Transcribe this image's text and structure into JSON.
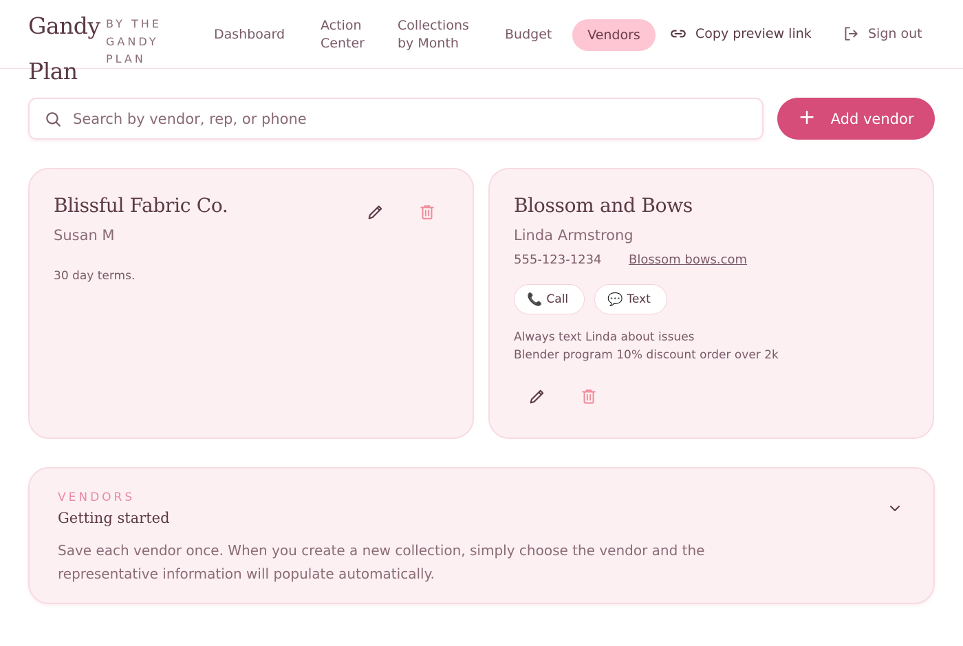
{
  "brand": {
    "line1": "Gandy",
    "line2": "Plan",
    "sub1": "BY THE",
    "sub2": "GANDY",
    "sub3": "PLAN"
  },
  "nav": {
    "dashboard": "Dashboard",
    "action_line1": "Action",
    "action_line2": "Center",
    "collections_line1": "Collections",
    "collections_line2": "by Month",
    "budget": "Budget",
    "vendors": "Vendors",
    "copy_link": "Copy preview link",
    "sign_out": "Sign out"
  },
  "search": {
    "placeholder": "Search by vendor, rep, or phone",
    "value": ""
  },
  "add_vendor": {
    "plus": "+",
    "label": "Add vendor"
  },
  "vendors": [
    {
      "name": "Blissful Fabric Co.",
      "rep": "Susan M",
      "note": "30 day terms."
    },
    {
      "name": "Blossom and Bows",
      "rep": "Linda Armstrong",
      "phone": "555-123-1234",
      "website": "Blossom bows.com",
      "call_label": "Call",
      "text_label": "Text",
      "note_line1": "Always text Linda about issues",
      "note_line2": "Blender program 10% discount order over 2k"
    }
  ],
  "panel": {
    "eyebrow": "VENDORS",
    "title": "Getting started",
    "body": "Save each vendor once. When you create a new collection, simply choose the vendor and the representative information will populate automatically."
  },
  "colors": {
    "accent": "#d54d78",
    "active_nav": "#fdc6d2",
    "card_bg": "#fdf0f2",
    "trash": "#f08a9a"
  }
}
